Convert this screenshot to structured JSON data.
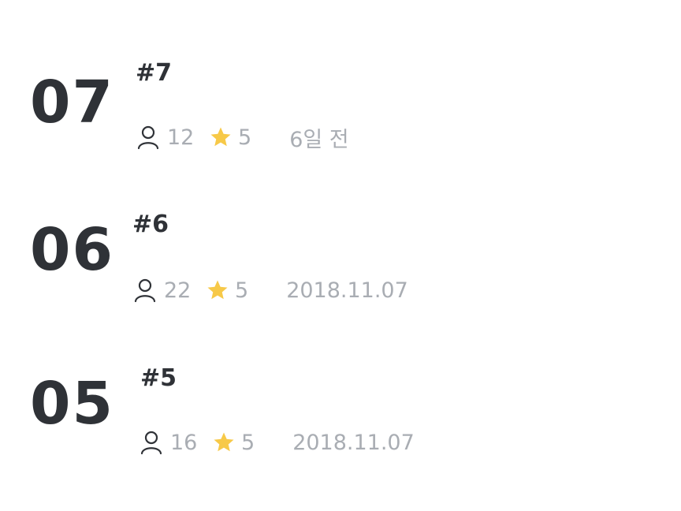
{
  "episodes": [
    {
      "number": "07",
      "title": "#7",
      "views": "12",
      "rating": "5",
      "date": "6일 전"
    },
    {
      "number": "06",
      "title": "#6",
      "views": "22",
      "rating": "5",
      "date": "2018.11.07"
    },
    {
      "number": "05",
      "title": "#5",
      "views": "16",
      "rating": "5",
      "date": "2018.11.07"
    }
  ],
  "icons": {
    "views": "person-icon",
    "rating": "star-icon"
  },
  "colors": {
    "text_dark": "#2f3237",
    "text_muted": "#a9adb3",
    "star": "#f7c948"
  }
}
